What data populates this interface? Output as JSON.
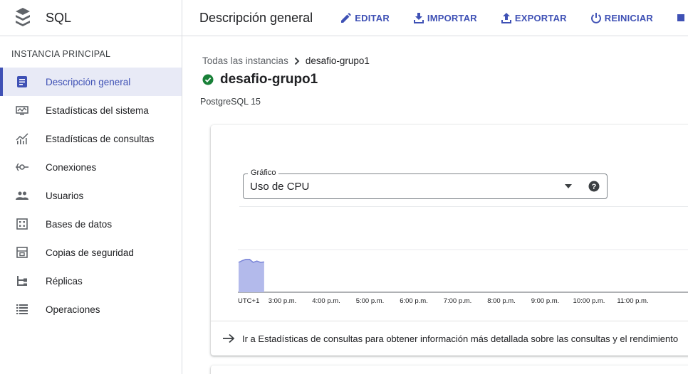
{
  "app": {
    "name": "SQL"
  },
  "sidebar": {
    "section_title": "INSTANCIA PRINCIPAL",
    "items": [
      {
        "label": "Descripción general",
        "icon": "overview-icon"
      },
      {
        "label": "Estadísticas del sistema",
        "icon": "system-stats-icon"
      },
      {
        "label": "Estadísticas de consultas",
        "icon": "query-stats-icon"
      },
      {
        "label": "Conexiones",
        "icon": "connections-icon"
      },
      {
        "label": "Usuarios",
        "icon": "users-icon"
      },
      {
        "label": "Bases de datos",
        "icon": "databases-icon"
      },
      {
        "label": "Copias de seguridad",
        "icon": "backups-icon"
      },
      {
        "label": "Réplicas",
        "icon": "replicas-icon"
      },
      {
        "label": "Operaciones",
        "icon": "operations-icon"
      }
    ]
  },
  "header": {
    "title": "Descripción general",
    "actions": {
      "edit": "EDITAR",
      "import": "IMPORTAR",
      "export": "EXPORTAR",
      "restart": "REINICIAR"
    }
  },
  "breadcrumb": {
    "root": "Todas las instancias",
    "current": "desafio-grupo1"
  },
  "instance": {
    "name": "desafio-grupo1",
    "version": "PostgreSQL 15",
    "status": "running"
  },
  "chart_panel": {
    "select_label": "Gráfico",
    "select_value": "Uso de CPU",
    "footer_link": "Ir a Estadísticas de consultas para obtener información más detallada sobre las consultas y el rendimiento"
  },
  "chart_data": {
    "type": "area",
    "title": "",
    "xlabel": "",
    "ylabel": "",
    "timezone_label": "UTC+1",
    "x_ticks": [
      "3:00 p.m.",
      "4:00 p.m.",
      "5:00 p.m.",
      "6:00 p.m.",
      "7:00 p.m.",
      "8:00 p.m.",
      "9:00 p.m.",
      "10:00 p.m.",
      "11:00 p.m."
    ],
    "series": [
      {
        "x": [
          "2:00 p.m.",
          "2:05 p.m.",
          "2:10 p.m.",
          "2:15 p.m.",
          "2:20 p.m.",
          "2:25 p.m.",
          "2:30 p.m.",
          "2:35 p.m."
        ],
        "values": [
          0.7,
          0.74,
          0.77,
          0.77,
          0.7,
          0.73,
          0.7,
          0.71
        ]
      }
    ],
    "ylim": [
      0,
      1
    ],
    "grid": true,
    "colors": {
      "fill": "#b3baeb",
      "stroke": "#7b86d8"
    }
  },
  "colors": {
    "accent": "#3f51b5",
    "active_bg": "#e8eaf6",
    "status_ok": "#188038"
  }
}
